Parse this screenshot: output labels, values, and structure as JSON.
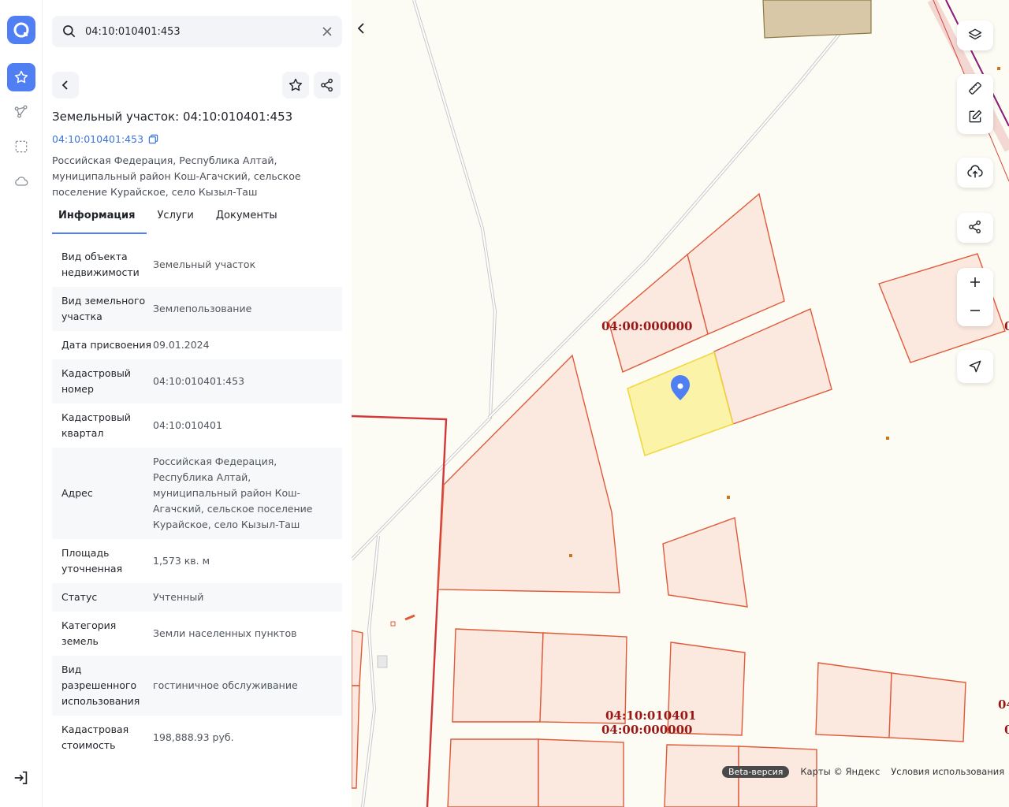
{
  "search": {
    "value": "04:10:010401:453"
  },
  "parcel": {
    "title": "Земельный участок: 04:10:010401:453",
    "cad_number": "04:10:010401:453",
    "address": "Российская Федерация, Республика Алтай, муниципальный район Кош-Агачский, сельское поселение Курайское, село Кызыл-Таш"
  },
  "tabs": [
    {
      "label": "Информация",
      "active": true
    },
    {
      "label": "Услуги",
      "active": false
    },
    {
      "label": "Документы",
      "active": false
    }
  ],
  "info_rows": [
    {
      "key": "Вид объекта недвижимости",
      "value": "Земельный участок"
    },
    {
      "key": "Вид земельного участка",
      "value": "Землепользование"
    },
    {
      "key": "Дата присвоения",
      "value": "09.01.2024"
    },
    {
      "key": "Кадастровый номер",
      "value": "04:10:010401:453"
    },
    {
      "key": "Кадастровый квартал",
      "value": "04:10:010401"
    },
    {
      "key": "Адрес",
      "value": "Российская Федерация, Республика Алтай, муниципальный район Кош-Агачский, сельское поселение Курайское, село Кызыл-Таш"
    },
    {
      "key": "Площадь уточненная",
      "value": "1,573 кв. м"
    },
    {
      "key": "Статус",
      "value": "Учтенный"
    },
    {
      "key": "Категория земель",
      "value": "Земли населенных пунктов"
    },
    {
      "key": "Вид разрешенного использования",
      "value": "гостиничное обслуживание"
    },
    {
      "key": "Кадастровая стоимость",
      "value": "198,888.93 руб."
    }
  ],
  "map": {
    "labels": {
      "l1": "04:00:000000",
      "l2": "04:10:010401",
      "l3": "04:00:000000",
      "edge1": "0",
      "edge2": "04",
      "edge3": "0"
    },
    "colors": {
      "parcel_fill": "#fbe8df",
      "parcel_stroke": "#e05a3a",
      "selected_fill": "#fbf3a3",
      "selected_stroke": "#f0d73a",
      "quarter_stroke": "#d2383a",
      "accent": "#4f7ff3"
    }
  },
  "attribution": {
    "beta": "Beta-версия",
    "maps": "Карты © Яндекс",
    "terms": "Условия использования"
  }
}
